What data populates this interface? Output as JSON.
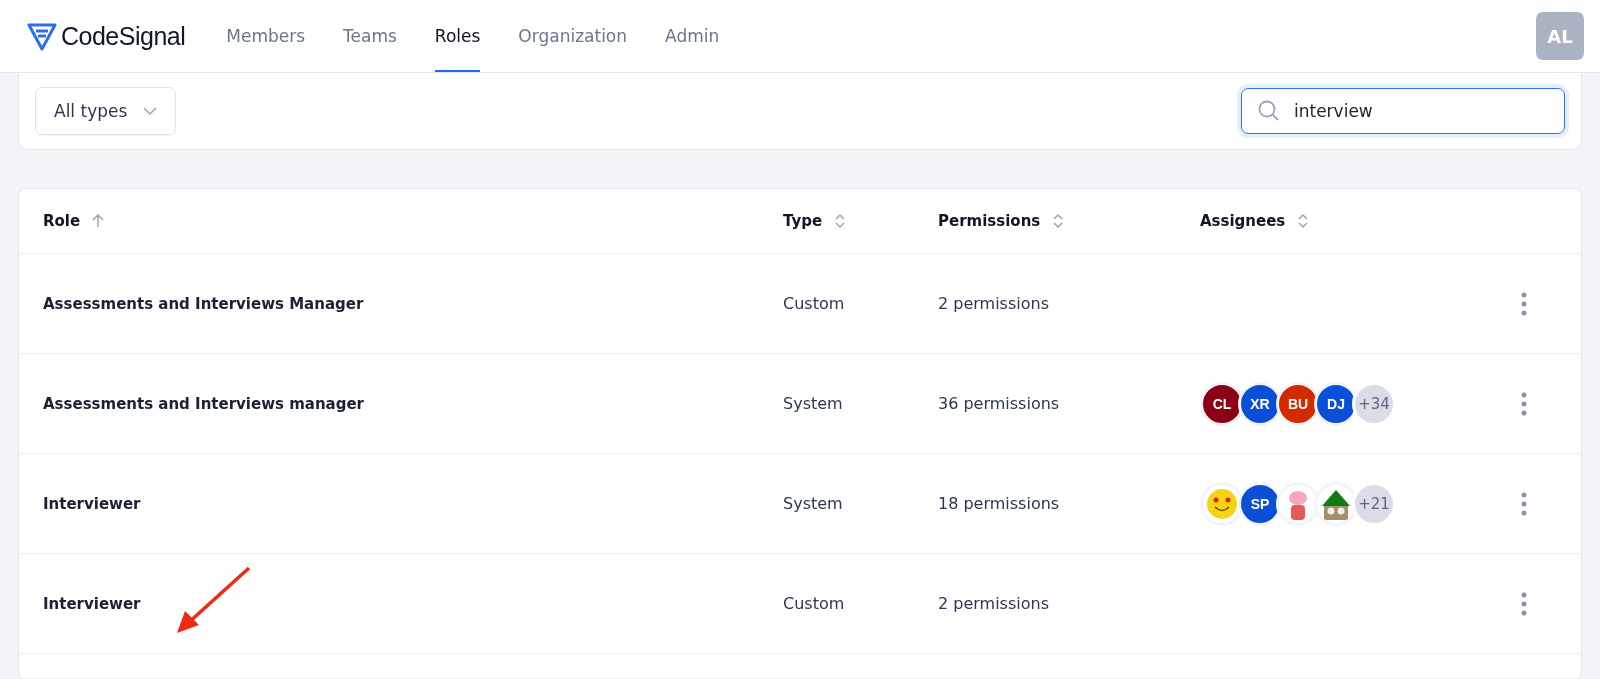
{
  "brand": {
    "name": "CodeSignal"
  },
  "nav": [
    {
      "label": "Members",
      "selected": false
    },
    {
      "label": "Teams",
      "selected": false
    },
    {
      "label": "Roles",
      "selected": true
    },
    {
      "label": "Organization",
      "selected": false
    },
    {
      "label": "Admin",
      "selected": false
    }
  ],
  "user_avatar": {
    "initials": "AL"
  },
  "filter": {
    "value": "All types"
  },
  "search": {
    "value": "interview"
  },
  "table": {
    "columns": [
      {
        "label": "Role",
        "sorted": true
      },
      {
        "label": "Type",
        "sorted": false
      },
      {
        "label": "Permissions",
        "sorted": false
      },
      {
        "label": "Assignees",
        "sorted": false
      }
    ],
    "rows": [
      {
        "role": "Assessments and Interviews Manager",
        "type": "Custom",
        "permissions": "2 permissions",
        "assignees": [],
        "arrow": false
      },
      {
        "role": "Assessments and Interviews manager",
        "type": "System",
        "permissions": "36 permissions",
        "assignees": [
          {
            "kind": "initials",
            "initials": "CL",
            "color": "#8b0016"
          },
          {
            "kind": "initials",
            "initials": "XR",
            "color": "#0b4fd6"
          },
          {
            "kind": "initials",
            "initials": "BU",
            "color": "#d42a00"
          },
          {
            "kind": "initials",
            "initials": "DJ",
            "color": "#0b4fd6"
          }
        ],
        "more": "+34",
        "arrow": false
      },
      {
        "role": "Interviewer",
        "type": "System",
        "permissions": "18 permissions",
        "assignees": [
          {
            "kind": "smiley"
          },
          {
            "kind": "initials",
            "initials": "SP",
            "color": "#0b4fd6"
          },
          {
            "kind": "pig"
          },
          {
            "kind": "gnome"
          }
        ],
        "more": "+21",
        "arrow": false
      },
      {
        "role": "Interviewer",
        "type": "Custom",
        "permissions": "2 permissions",
        "assignees": [],
        "arrow": true
      }
    ]
  }
}
